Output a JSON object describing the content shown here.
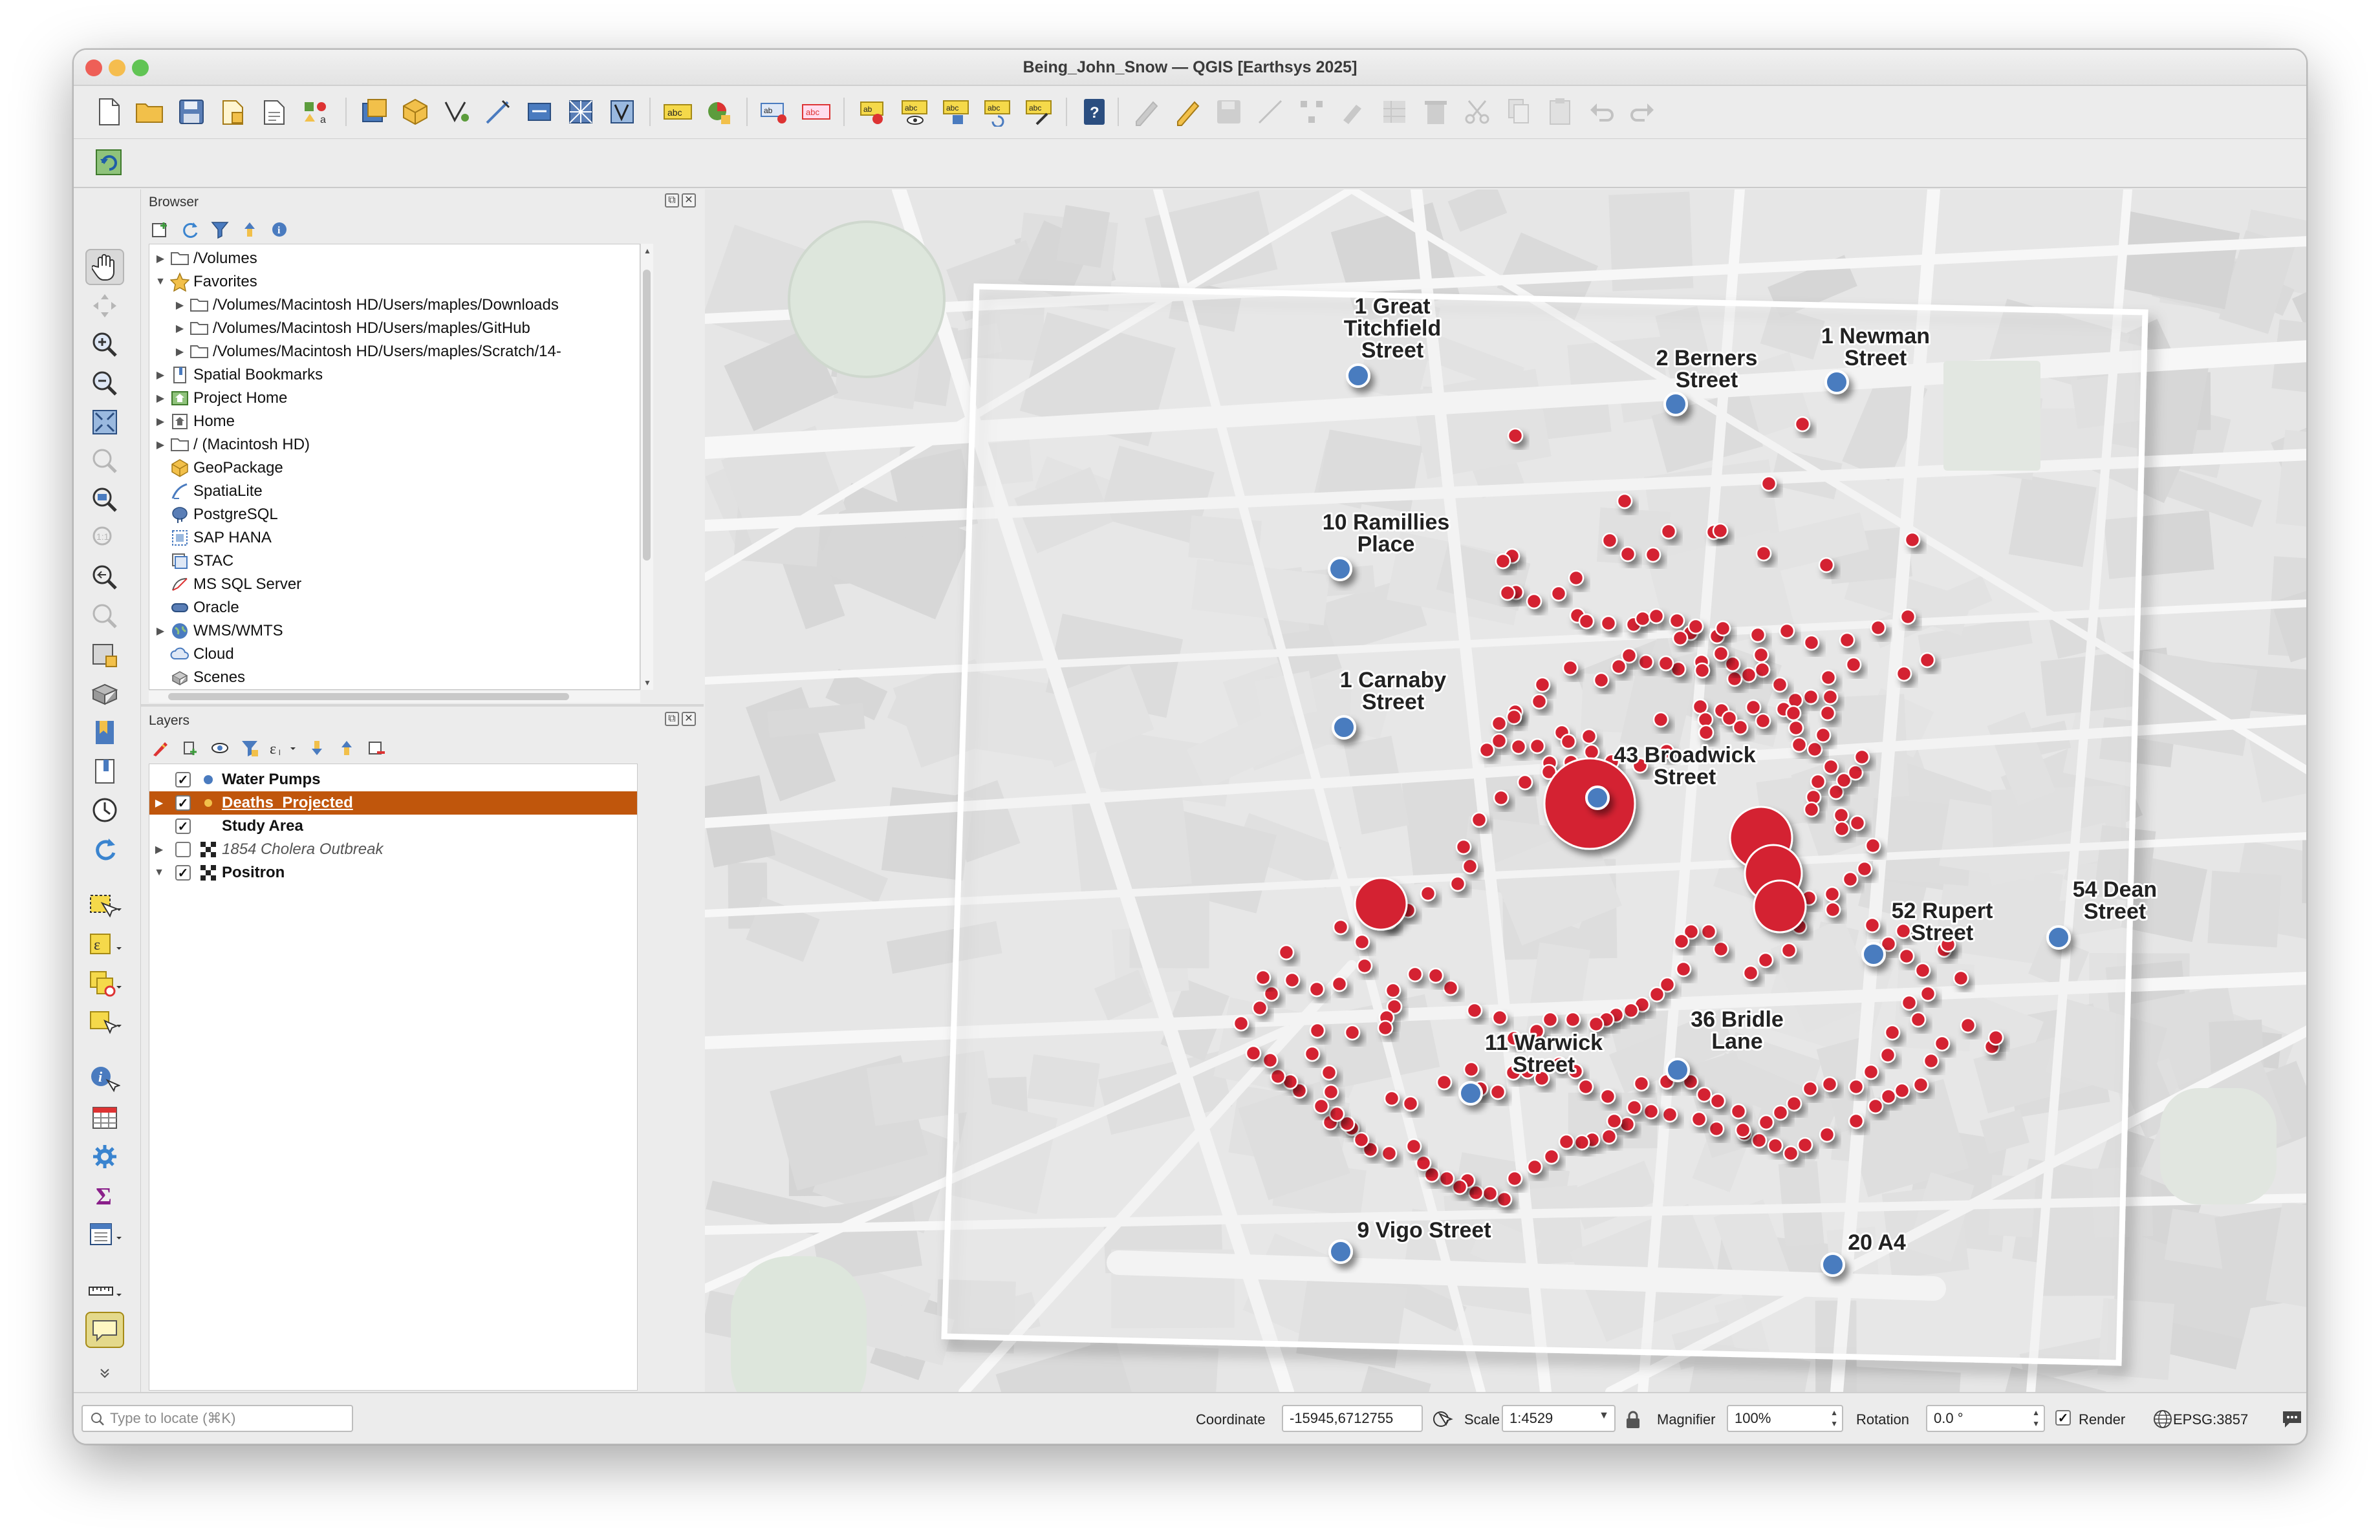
{
  "window": {
    "title": "Being_John_Snow — QGIS [Earthsys 2025]",
    "traffic_colors": [
      "#ee5f57",
      "#f5bd4f",
      "#61c454"
    ]
  },
  "browser_panel": {
    "title": "Browser",
    "tools": [
      "add-layer-icon",
      "refresh-icon",
      "filter-icon",
      "collapse-all-icon",
      "info-icon"
    ],
    "items": [
      {
        "label": "/Volumes",
        "indent": 0,
        "expander": "right",
        "icon": "folder-icon"
      },
      {
        "label": "Favorites",
        "indent": 0,
        "expander": "down",
        "icon": "star-icon"
      },
      {
        "label": "/Volumes/Macintosh HD/Users/maples/Downloads",
        "indent": 1,
        "expander": "right",
        "icon": "folder-icon"
      },
      {
        "label": "/Volumes/Macintosh HD/Users/maples/GitHub",
        "indent": 1,
        "expander": "right",
        "icon": "folder-icon"
      },
      {
        "label": "/Volumes/Macintosh HD/Users/maples/Scratch/14-",
        "indent": 1,
        "expander": "right",
        "icon": "folder-icon"
      },
      {
        "label": "Spatial Bookmarks",
        "indent": 0,
        "expander": "right",
        "icon": "bookmark-icon"
      },
      {
        "label": "Project Home",
        "indent": 0,
        "expander": "right",
        "icon": "project-home-icon"
      },
      {
        "label": "Home",
        "indent": 0,
        "expander": "right",
        "icon": "home-icon"
      },
      {
        "label": "/ (Macintosh HD)",
        "indent": 0,
        "expander": "right",
        "icon": "folder-icon"
      },
      {
        "label": "GeoPackage",
        "indent": 0,
        "expander": "",
        "icon": "geopackage-icon"
      },
      {
        "label": "SpatiaLite",
        "indent": 0,
        "expander": "",
        "icon": "spatialite-icon"
      },
      {
        "label": "PostgreSQL",
        "indent": 0,
        "expander": "",
        "icon": "postgresql-icon"
      },
      {
        "label": "SAP HANA",
        "indent": 0,
        "expander": "",
        "icon": "sap-hana-icon"
      },
      {
        "label": "STAC",
        "indent": 0,
        "expander": "",
        "icon": "stac-icon"
      },
      {
        "label": "MS SQL Server",
        "indent": 0,
        "expander": "",
        "icon": "mssql-icon"
      },
      {
        "label": "Oracle",
        "indent": 0,
        "expander": "",
        "icon": "oracle-icon"
      },
      {
        "label": "WMS/WMTS",
        "indent": 0,
        "expander": "right",
        "icon": "globe-icon"
      },
      {
        "label": "Cloud",
        "indent": 0,
        "expander": "",
        "icon": "cloud-icon"
      },
      {
        "label": "Scenes",
        "indent": 0,
        "expander": "",
        "icon": "scenes-icon"
      }
    ]
  },
  "layers_panel": {
    "title": "Layers",
    "tools": [
      "style-icon",
      "add-group-icon",
      "visibility-icon",
      "filter-legend-icon",
      "expression-filter-icon",
      "expand-all-icon",
      "collapse-all-icon",
      "remove-layer-icon"
    ],
    "items": [
      {
        "label": "Water Pumps",
        "checked": true,
        "bold": true,
        "italic": false,
        "selected": false,
        "expander": "",
        "icon": "point-symbol-icon"
      },
      {
        "label": "Deaths_Projected",
        "checked": true,
        "bold": true,
        "italic": false,
        "selected": true,
        "expander": "right",
        "icon": "graduated-symbol-icon"
      },
      {
        "label": "Study Area",
        "checked": true,
        "bold": true,
        "italic": false,
        "selected": false,
        "expander": "",
        "icon": "polygon-symbol-icon"
      },
      {
        "label": "1854 Cholera Outbreak",
        "checked": false,
        "bold": false,
        "italic": true,
        "selected": false,
        "expander": "right",
        "icon": "raster-icon"
      },
      {
        "label": "Positron",
        "checked": true,
        "bold": true,
        "italic": false,
        "selected": false,
        "expander": "down",
        "icon": "raster-icon"
      }
    ],
    "selected_color": "#c0560c"
  },
  "map": {
    "background": "#e6e6e6",
    "pump_color": "#4a7bbf",
    "death_color": "#d42430",
    "pumps": [
      {
        "label": "1 Great Titchfield Street",
        "lines": [
          "1 Great",
          "Titchfield",
          "Street"
        ]
      },
      {
        "label": "2 Berners Street",
        "lines": [
          "2 Berners",
          "Street"
        ]
      },
      {
        "label": "1 Newman Street",
        "lines": [
          "1 Newman",
          "Street"
        ]
      },
      {
        "label": "10 Ramillies Place",
        "lines": [
          "10 Ramillies",
          "Place"
        ]
      },
      {
        "label": "1 Carnaby Street",
        "lines": [
          "1 Carnaby",
          "Street"
        ]
      },
      {
        "label": "43 Broadwick Street",
        "lines": [
          "43 Broadwick",
          "Street"
        ]
      },
      {
        "label": "52 Rupert Street",
        "lines": [
          "52 Rupert",
          "Street"
        ]
      },
      {
        "label": "54 Dean Street",
        "lines": [
          "54 Dean",
          "Street"
        ]
      },
      {
        "label": "36 Bridle Lane",
        "lines": [
          "36 Bridle",
          "Lane"
        ]
      },
      {
        "label": "11 Warwick Street",
        "lines": [
          "11 Warwick",
          "Street"
        ]
      },
      {
        "label": "9 Vigo Street",
        "lines": [
          "9 Vigo Street"
        ]
      },
      {
        "label": "20 A4",
        "lines": [
          "20 A4"
        ]
      }
    ]
  },
  "statusbar": {
    "locator_placeholder": "Type to locate (⌘K)",
    "coordinate_label": "Coordinate",
    "coordinate_value": "-15945,6712755",
    "scale_label": "Scale",
    "scale_value": "1:4529",
    "magnifier_label": "Magnifier",
    "magnifier_value": "100%",
    "rotation_label": "Rotation",
    "rotation_value": "0.0 °",
    "render_label": "Render",
    "render_checked": true,
    "crs_label": "EPSG:3857"
  }
}
